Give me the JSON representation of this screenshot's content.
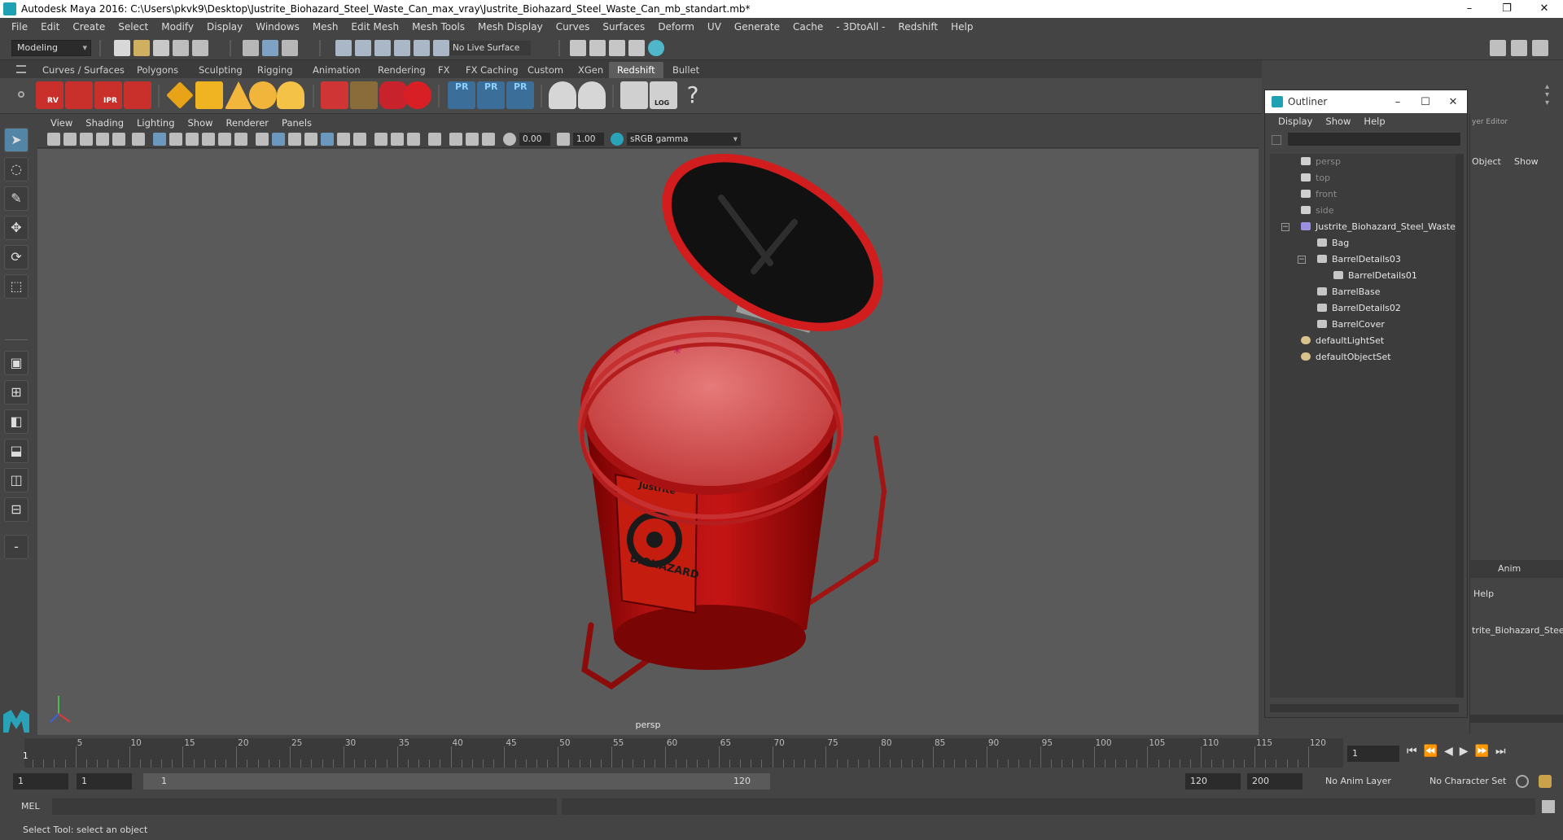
{
  "window": {
    "title": "Autodesk Maya 2016: C:\\Users\\pkvk9\\Desktop\\Justrite_Biohazard_Steel_Waste_Can_max_vray\\Justrite_Biohazard_Steel_Waste_Can_mb_standart.mb*",
    "minimize": "–",
    "restore": "❐",
    "close": "✕"
  },
  "menubar": [
    "File",
    "Edit",
    "Create",
    "Select",
    "Modify",
    "Display",
    "Windows",
    "Mesh",
    "Edit Mesh",
    "Mesh Tools",
    "Mesh Display",
    "Curves",
    "Surfaces",
    "Deform",
    "UV",
    "Generate",
    "Cache",
    "- 3DtoAll -",
    "Redshift",
    "Help"
  ],
  "statusline": {
    "mode": "Modeling",
    "live_surface": "No Live Surface"
  },
  "shelf_tabs": [
    "Curves / Surfaces",
    "Polygons",
    "Sculpting",
    "Rigging",
    "Animation",
    "Rendering",
    "FX",
    "FX Caching",
    "Custom",
    "XGen",
    "Redshift",
    "Bullet"
  ],
  "active_shelf_tab": "Redshift",
  "shelf_icon_labels": {
    "rv": "RV",
    "ipr": "IPR",
    "pr1": "PR",
    "pr2": "PR",
    "pr3": "PR",
    "log": "LOG",
    "help": "?"
  },
  "panel_menu": [
    "View",
    "Shading",
    "Lighting",
    "Show",
    "Renderer",
    "Panels"
  ],
  "panel_toolbar": {
    "exposure": "0.00",
    "gamma": "1.00",
    "color_space": "sRGB gamma"
  },
  "viewport": {
    "camera_label": "persp",
    "object_label": "BIOHAZARD",
    "brand_label": "Justrite"
  },
  "outliner": {
    "title": "Outliner",
    "menu": [
      "Display",
      "Show",
      "Help"
    ],
    "items": [
      {
        "label": "persp",
        "type": "camera",
        "indent": 0
      },
      {
        "label": "top",
        "type": "camera",
        "indent": 0
      },
      {
        "label": "front",
        "type": "camera",
        "indent": 0
      },
      {
        "label": "side",
        "type": "camera",
        "indent": 0
      },
      {
        "label": "Justrite_Biohazard_Steel_Waste_C",
        "type": "group",
        "indent": 0
      },
      {
        "label": "Bag",
        "type": "mesh",
        "indent": 1
      },
      {
        "label": "BarrelDetails03",
        "type": "mesh",
        "indent": 1
      },
      {
        "label": "BarrelDetails01",
        "type": "mesh",
        "indent": 2
      },
      {
        "label": "BarrelBase",
        "type": "mesh",
        "indent": 1
      },
      {
        "label": "BarrelDetails02",
        "type": "mesh",
        "indent": 1
      },
      {
        "label": "BarrelCover",
        "type": "mesh",
        "indent": 1
      },
      {
        "label": "defaultLightSet",
        "type": "set",
        "indent": 0
      },
      {
        "label": "defaultObjectSet",
        "type": "set",
        "indent": 0
      }
    ]
  },
  "channel_box": {
    "layer_editor": "yer Editor",
    "object": "Object",
    "show": "Show",
    "anim": "Anim",
    "help": "Help",
    "selected": "trite_Biohazard_Steel_"
  },
  "time_slider": {
    "ticks": [
      "5",
      "10",
      "15",
      "20",
      "25",
      "30",
      "35",
      "40",
      "45",
      "50",
      "55",
      "60",
      "65",
      "70",
      "75",
      "80",
      "85",
      "90",
      "95",
      "100",
      "105",
      "110",
      "115",
      "120"
    ],
    "current_frame_marker": "1",
    "current_frame": "1"
  },
  "range_slider": {
    "start": "1",
    "playback_start": "1",
    "range_start": "1",
    "range_end": "120",
    "playback_end": "120",
    "end": "200",
    "anim_layer": "No Anim Layer",
    "character_set": "No Character Set"
  },
  "command_line": {
    "language": "MEL"
  },
  "help_line": "Select Tool: select an object"
}
